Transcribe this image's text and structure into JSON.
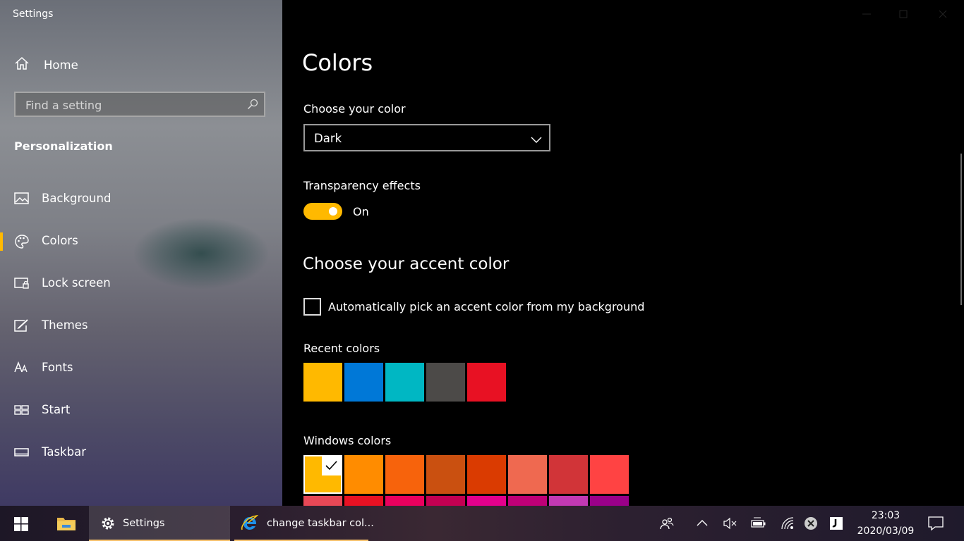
{
  "window": {
    "title": "Settings"
  },
  "sidebar": {
    "home_label": "Home",
    "search_placeholder": "Find a setting",
    "section_title": "Personalization",
    "items": [
      {
        "label": "Background",
        "icon": "picture-icon",
        "selected": false
      },
      {
        "label": "Colors",
        "icon": "palette-icon",
        "selected": true
      },
      {
        "label": "Lock screen",
        "icon": "lock-screen-icon",
        "selected": false
      },
      {
        "label": "Themes",
        "icon": "themes-icon",
        "selected": false
      },
      {
        "label": "Fonts",
        "icon": "fonts-icon",
        "selected": false
      },
      {
        "label": "Start",
        "icon": "start-icon",
        "selected": false
      },
      {
        "label": "Taskbar",
        "icon": "taskbar-icon",
        "selected": false
      }
    ]
  },
  "main": {
    "title": "Colors",
    "choose_color_label": "Choose your color",
    "choose_color_value": "Dark",
    "transparency_label": "Transparency effects",
    "transparency_state": "On",
    "accent_heading": "Choose your accent color",
    "auto_accent_label": "Automatically pick an accent color from my background",
    "recent_colors_label": "Recent colors",
    "recent_colors": [
      "#ffb900",
      "#0078d7",
      "#00b7c3",
      "#4c4a48",
      "#e81123"
    ],
    "windows_colors_label": "Windows colors",
    "windows_colors_row1": [
      "#ffb900",
      "#ff8c00",
      "#f7630c",
      "#ca5010",
      "#da3b01",
      "#ef6950",
      "#d13438",
      "#ff4343"
    ],
    "windows_colors_row2": [
      "#e74856",
      "#e81123",
      "#ea005e",
      "#c30052",
      "#e3008c",
      "#bf0077",
      "#c239b3",
      "#9a0089"
    ]
  },
  "taskbar": {
    "tasks": [
      {
        "label": "Settings",
        "icon": "gear-icon"
      },
      {
        "label": "change taskbar col...",
        "icon": "internet-explorer-icon"
      }
    ],
    "time": "23:03",
    "date": "2020/03/09"
  },
  "colors": {
    "accent": "#ffb900"
  }
}
